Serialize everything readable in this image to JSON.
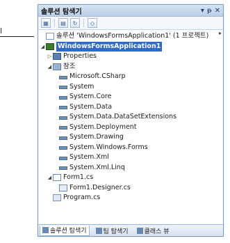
{
  "edge_marks": {
    "top": "",
    "mid": "l"
  },
  "window": {
    "title": "솔루션 탐색기",
    "controls": [
      "▾",
      "ᵽ",
      "✕"
    ]
  },
  "toolbar": {
    "icons": [
      "properties-icon",
      "show-all-files-icon",
      "refresh-icon",
      "view-class-diagram-icon"
    ]
  },
  "tree": {
    "solution": "솔루션 'WindowsFormsApplication1' (1 프로젝트)",
    "project": "WindowsFormsApplication1",
    "properties": "Properties",
    "references": "참조",
    "refs": [
      "Microsoft.CSharp",
      "System",
      "System.Core",
      "System.Data",
      "System.Data.DataSetExtensions",
      "System.Deployment",
      "System.Drawing",
      "System.Windows.Forms",
      "System.Xml",
      "System.Xml.Linq"
    ],
    "form": "Form1.cs",
    "form_designer": "Form1.Designer.cs",
    "program": "Program.cs"
  },
  "bottom_tabs": [
    "솔루션 탐색기",
    "팀 탐색기",
    "클래스 뷰"
  ]
}
